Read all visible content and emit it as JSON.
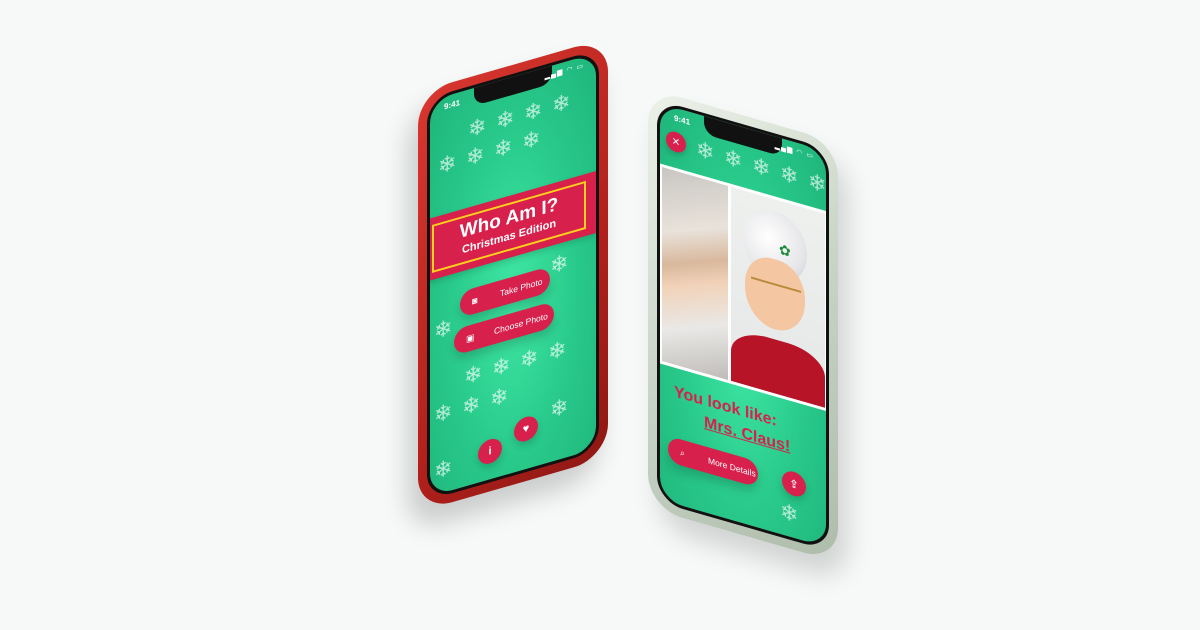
{
  "left_phone": {
    "status_time": "9:41",
    "status_icons": "▂▄▆ ◠ ▭",
    "title": "Who Am I?",
    "subtitle": "Christmas Edition",
    "take_photo_label": "Take Photo",
    "choose_photo_label": "Choose Photo",
    "info_button_glyph": "i",
    "favorite_button_glyph": "♥"
  },
  "right_phone": {
    "status_time": "9:41",
    "status_icons": "▂▄▆ ◠ ▭",
    "close_glyph": "✕",
    "result_prefix": "You look like:",
    "result_name": "Mrs. Claus!",
    "more_details_label": "More Details",
    "share_glyph": "⇪"
  },
  "colors": {
    "accent_red": "#d8204c",
    "screen_green": "#28c98a",
    "banner_border": "#ffd11c",
    "red_phone_body": "#c42a24",
    "green_phone_body": "#c8d4c6"
  },
  "icons": {
    "snowflake": "snowflake-icon",
    "camera": "camera-icon",
    "image": "image-icon",
    "search": "search-icon",
    "info": "info-icon",
    "heart": "heart-icon",
    "close": "close-icon",
    "share": "share-icon"
  }
}
